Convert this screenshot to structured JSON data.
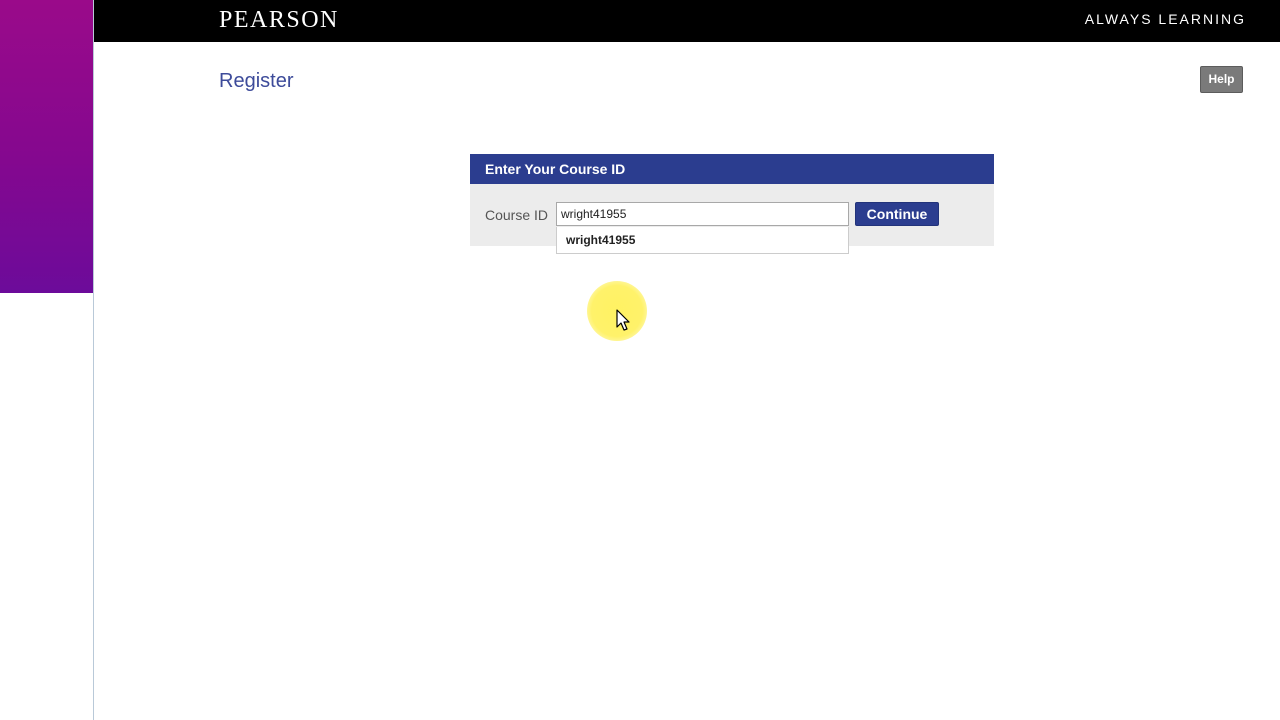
{
  "header": {
    "logo": "PEARSON",
    "tagline": "ALWAYS LEARNING"
  },
  "page": {
    "title": "Register",
    "help_label": "Help"
  },
  "course_panel": {
    "heading": "Enter Your Course ID",
    "field_label": "Course ID",
    "input_value": "wright41955",
    "continue_label": "Continue",
    "suggestions": [
      "wright41955"
    ]
  },
  "colors": {
    "brand_blue": "#2b3d8f",
    "title_blue": "#3d4b9a",
    "side_purple": "#84088f",
    "help_gray": "#7a7a7a"
  },
  "icons": {
    "cursor": "mouse-pointer-icon"
  }
}
